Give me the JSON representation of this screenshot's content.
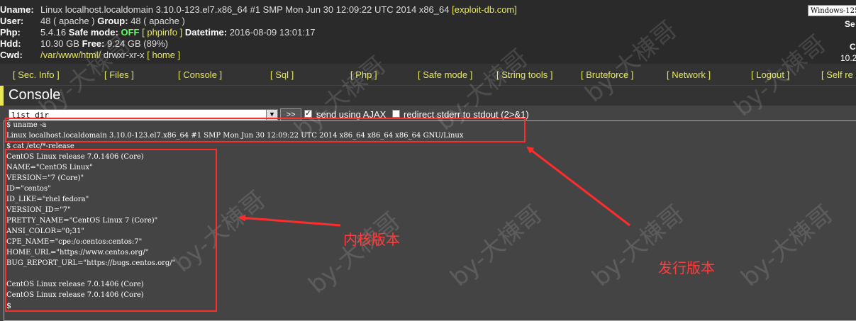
{
  "header": {
    "uname_label": "Uname:",
    "uname_value": "Linux localhost.localdomain 3.10.0-123.el7.x86_64 #1 SMP Mon Jun 30 12:09:22 UTC 2014 x86_64",
    "uname_link": "[exploit-db.com]",
    "user_label": "User:",
    "user_value": "48 ( apache )",
    "group_label": "Group:",
    "group_value": "48 ( apache )",
    "php_label": "Php:",
    "php_value": "5.4.16",
    "safe_mode_label": "Safe mode:",
    "safe_mode_value": "OFF",
    "phpinfo_link": "[ phpinfo ]",
    "datetime_label": "Datetime:",
    "datetime_value": "2016-08-09 13:01:17",
    "hdd_label": "Hdd:",
    "hdd_value": "10.30 GB",
    "free_label": "Free:",
    "free_value": "9.24 GB (89%)",
    "cwd_label": "Cwd:",
    "cwd_path": "/var/www/html/",
    "cwd_perms": "drwxr-xr-x",
    "home_link": "[ home ]",
    "encoding_select": "Windows-125",
    "right_fragments": [
      "Se",
      "C",
      "10.2"
    ]
  },
  "nav": [
    "[ Sec. Info ]",
    "[ Files ]",
    "[ Console ]",
    "[ Sql ]",
    "[ Php ]",
    "[ Safe mode ]",
    "[ String tools ]",
    "[ Bruteforce ]",
    "[ Network ]",
    "[ Logout ]",
    "[ Self re"
  ],
  "title": "Console",
  "controls": {
    "command_select": "list dir",
    "go_button": ">>",
    "ajax_label": "send using AJAX",
    "ajax_checked": true,
    "redirect_label": "redirect stderr to stdout (2>&1)",
    "redirect_checked": false
  },
  "output_lines": [
    "$ uname -a",
    "Linux localhost.localdomain 3.10.0-123.el7.x86_64 #1 SMP Mon Jun 30 12:09:22 UTC 2014 x86_64 x86_64 x86_64 GNU/Linux",
    "$ cat /etc/*-release",
    "CentOS Linux release 7.0.1406 (Core)",
    "NAME=\"CentOS Linux\"",
    "VERSION=\"7 (Core)\"",
    "ID=\"centos\"",
    "ID_LIKE=\"rhel fedora\"",
    "VERSION_ID=\"7\"",
    "PRETTY_NAME=\"CentOS Linux 7 (Core)\"",
    "ANSI_COLOR=\"0;31\"",
    "CPE_NAME=\"cpe:/o:centos:centos:7\"",
    "HOME_URL=\"https://www.centos.org/\"",
    "BUG_REPORT_URL=\"https://bugs.centos.org/\"",
    "",
    "CentOS Linux release 7.0.1406 (Core)",
    "CentOS Linux release 7.0.1406 (Core)"
  ],
  "prompt": "$",
  "annotations": {
    "kernel_version": "内核版本",
    "release_version": "发行版本",
    "color": "#ff2c2c"
  },
  "watermark": "by-大棟哥"
}
